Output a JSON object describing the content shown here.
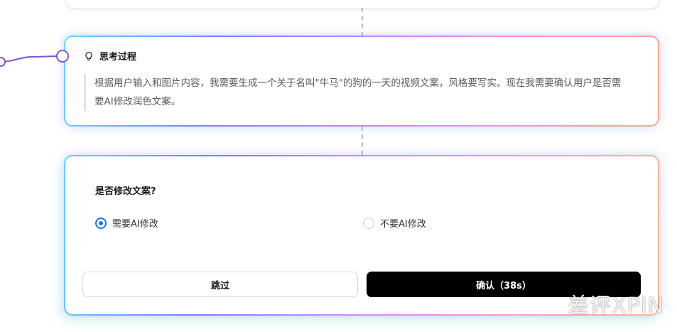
{
  "thinking": {
    "title": "思考过程",
    "body": "根据用户输入和图片内容，我需要生成一个关于名叫\"牛马\"的狗的一天的视频文案，风格要写实。现在我需要确认用户是否需要AI修改润色文案。"
  },
  "confirm": {
    "question": "是否修改文案?",
    "options": [
      {
        "label": "需要AI修改",
        "selected": true
      },
      {
        "label": "不要AI修改",
        "selected": false
      }
    ],
    "skip_label": "跳过",
    "ok_label": "确认（38s）"
  },
  "watermark": "差评XPIN",
  "colors": {
    "accent": "#1a73e8",
    "connector": "#7a57d1",
    "primary_button": "#000000"
  }
}
